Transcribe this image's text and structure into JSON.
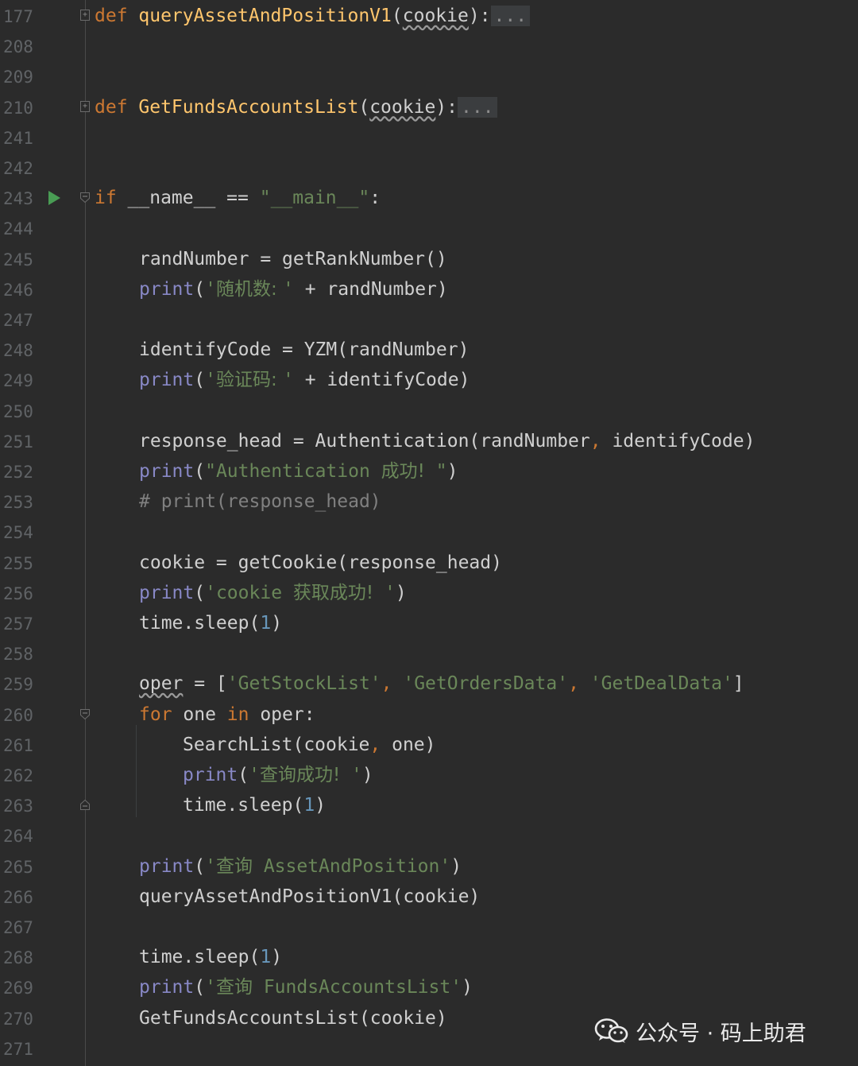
{
  "editor": {
    "lines": [
      {
        "num": "177",
        "indent": 0,
        "fold": "collapsed",
        "tokens": [
          [
            "def ",
            "kw"
          ],
          [
            "queryAssetAndPositionV1",
            "fn"
          ],
          [
            "(",
            "par"
          ],
          [
            "cookie",
            "id",
            "warn"
          ],
          [
            "):",
            "par"
          ],
          [
            "...",
            "fold"
          ]
        ]
      },
      {
        "num": "208",
        "indent": 0,
        "tokens": []
      },
      {
        "num": "209",
        "indent": 0,
        "tokens": []
      },
      {
        "num": "210",
        "indent": 0,
        "fold": "collapsed",
        "tokens": [
          [
            "def ",
            "kw"
          ],
          [
            "GetFundsAccountsList",
            "fn"
          ],
          [
            "(",
            "par"
          ],
          [
            "cookie",
            "id",
            "warn"
          ],
          [
            "):",
            "par"
          ],
          [
            "...",
            "fold"
          ]
        ]
      },
      {
        "num": "241",
        "indent": 0,
        "tokens": []
      },
      {
        "num": "242",
        "indent": 0,
        "tokens": []
      },
      {
        "num": "243",
        "indent": 0,
        "run": true,
        "fold": "open",
        "tokens": [
          [
            "if ",
            "kw"
          ],
          [
            "__name__ == ",
            "id"
          ],
          [
            "\"__main__\"",
            "str"
          ],
          [
            ":",
            "par"
          ]
        ]
      },
      {
        "num": "244",
        "indent": 0,
        "tokens": []
      },
      {
        "num": "245",
        "indent": 1,
        "tokens": [
          [
            "randNumber = getRankNumber()",
            "id"
          ]
        ]
      },
      {
        "num": "246",
        "indent": 1,
        "tokens": [
          [
            "print",
            "bi"
          ],
          [
            "(",
            "par"
          ],
          [
            "'",
            "str"
          ],
          [
            "随机数: ",
            "str",
            "cjk"
          ],
          [
            "' ",
            "str"
          ],
          [
            "+ randNumber)",
            "id"
          ]
        ]
      },
      {
        "num": "247",
        "indent": 0,
        "tokens": []
      },
      {
        "num": "248",
        "indent": 1,
        "tokens": [
          [
            "identifyCode = YZM(randNumber)",
            "id"
          ]
        ]
      },
      {
        "num": "249",
        "indent": 1,
        "tokens": [
          [
            "print",
            "bi"
          ],
          [
            "(",
            "par"
          ],
          [
            "'",
            "str"
          ],
          [
            "验证码: ",
            "str",
            "cjk"
          ],
          [
            "' ",
            "str"
          ],
          [
            "+ identifyCode)",
            "id"
          ]
        ]
      },
      {
        "num": "250",
        "indent": 0,
        "tokens": []
      },
      {
        "num": "251",
        "indent": 1,
        "tokens": [
          [
            "response_head = Authentication(randNumber",
            "id"
          ],
          [
            ", ",
            "punc"
          ],
          [
            "identifyCode)",
            "id"
          ]
        ]
      },
      {
        "num": "252",
        "indent": 1,
        "tokens": [
          [
            "print",
            "bi"
          ],
          [
            "(",
            "par"
          ],
          [
            "\"Authentication ",
            "str"
          ],
          [
            "成功!",
            "str",
            "cjk"
          ],
          [
            " \"",
            "str"
          ],
          [
            ")",
            "par"
          ]
        ]
      },
      {
        "num": "253",
        "indent": 1,
        "tokens": [
          [
            "# print(response_head)",
            "cm"
          ]
        ]
      },
      {
        "num": "254",
        "indent": 0,
        "tokens": []
      },
      {
        "num": "255",
        "indent": 1,
        "tokens": [
          [
            "cookie = getCookie(response_head)",
            "id"
          ]
        ]
      },
      {
        "num": "256",
        "indent": 1,
        "tokens": [
          [
            "print",
            "bi"
          ],
          [
            "(",
            "par"
          ],
          [
            "'cookie ",
            "str"
          ],
          [
            "获取成功!",
            "str",
            "cjk"
          ],
          [
            " '",
            "str"
          ],
          [
            ")",
            "par"
          ]
        ]
      },
      {
        "num": "257",
        "indent": 1,
        "tokens": [
          [
            "time.sleep(",
            "id"
          ],
          [
            "1",
            "num"
          ],
          [
            ")",
            "par"
          ]
        ]
      },
      {
        "num": "258",
        "indent": 0,
        "tokens": []
      },
      {
        "num": "259",
        "indent": 1,
        "tokens": [
          [
            "oper",
            "id",
            "warn"
          ],
          [
            " = [",
            "id"
          ],
          [
            "'GetStockList'",
            "str"
          ],
          [
            ", ",
            "punc"
          ],
          [
            "'GetOrdersData'",
            "str"
          ],
          [
            ", ",
            "punc"
          ],
          [
            "'GetDealData'",
            "str"
          ],
          [
            "]",
            "par"
          ]
        ]
      },
      {
        "num": "260",
        "indent": 1,
        "fold": "open",
        "tokens": [
          [
            "for ",
            "kw"
          ],
          [
            "one ",
            "id"
          ],
          [
            "in ",
            "kw"
          ],
          [
            "oper:",
            "id"
          ]
        ]
      },
      {
        "num": "261",
        "indent": 2,
        "tokens": [
          [
            "SearchList(cookie",
            "id"
          ],
          [
            ", ",
            "punc"
          ],
          [
            "one)",
            "id"
          ]
        ]
      },
      {
        "num": "262",
        "indent": 2,
        "tokens": [
          [
            "print",
            "bi"
          ],
          [
            "(",
            "par"
          ],
          [
            "'",
            "str"
          ],
          [
            "查询成功!",
            "str",
            "cjk"
          ],
          [
            " '",
            "str"
          ],
          [
            ")",
            "par"
          ]
        ]
      },
      {
        "num": "263",
        "indent": 2,
        "fold": "end",
        "tokens": [
          [
            "time.sleep(",
            "id"
          ],
          [
            "1",
            "num"
          ],
          [
            ")",
            "par"
          ]
        ]
      },
      {
        "num": "264",
        "indent": 0,
        "tokens": []
      },
      {
        "num": "265",
        "indent": 1,
        "tokens": [
          [
            "print",
            "bi"
          ],
          [
            "(",
            "par"
          ],
          [
            "'",
            "str"
          ],
          [
            "查询",
            "str",
            "cjk"
          ],
          [
            " AssetAndPosition'",
            "str"
          ],
          [
            ")",
            "par"
          ]
        ]
      },
      {
        "num": "266",
        "indent": 1,
        "tokens": [
          [
            "queryAssetAndPositionV1(cookie)",
            "id"
          ]
        ]
      },
      {
        "num": "267",
        "indent": 0,
        "tokens": []
      },
      {
        "num": "268",
        "indent": 1,
        "tokens": [
          [
            "time.sleep(",
            "id"
          ],
          [
            "1",
            "num"
          ],
          [
            ")",
            "par"
          ]
        ]
      },
      {
        "num": "269",
        "indent": 1,
        "tokens": [
          [
            "print",
            "bi"
          ],
          [
            "(",
            "par"
          ],
          [
            "'",
            "str"
          ],
          [
            "查询",
            "str",
            "cjk"
          ],
          [
            " FundsAccountsList'",
            "str"
          ],
          [
            ")",
            "par"
          ]
        ]
      },
      {
        "num": "270",
        "indent": 1,
        "tokens": [
          [
            "GetFundsAccountsList(cookie)",
            "id"
          ]
        ]
      },
      {
        "num": "271",
        "indent": 0,
        "tokens": []
      }
    ]
  },
  "watermark": {
    "text": "公众号 · 码上助君",
    "icon": "wechat-icon"
  },
  "colors": {
    "background": "#2b2b2b",
    "keyword": "#cc7832",
    "function": "#ffc66d",
    "string": "#6a8759",
    "builtin": "#8888c6",
    "number": "#6897bb",
    "comment": "#808080",
    "run": "#499c54"
  }
}
